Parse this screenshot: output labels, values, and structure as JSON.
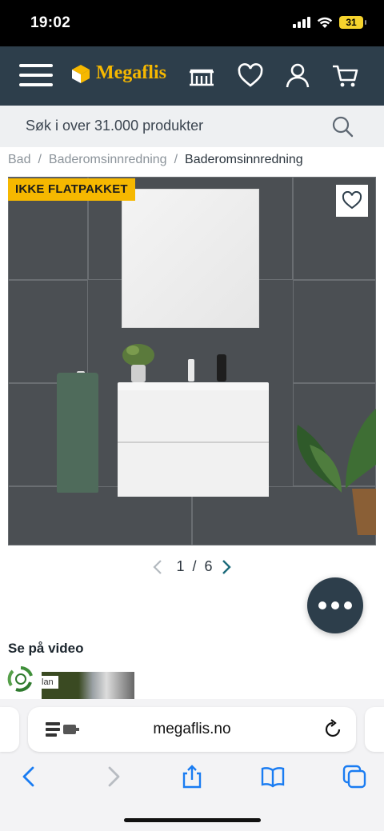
{
  "status": {
    "time": "19:02",
    "battery": "31"
  },
  "header": {
    "logo": "Megaflis"
  },
  "search": {
    "placeholder": "Søk i over 31.000 produkter"
  },
  "breadcrumb": {
    "items": [
      "Bad",
      "Baderomsinnredning"
    ],
    "current": "Baderomsinnredning",
    "separator": "/"
  },
  "product": {
    "badge": "IKKE FLATPAKKET"
  },
  "pager": {
    "current": "1",
    "separator": "/",
    "total": "6"
  },
  "video": {
    "title": "Se på video",
    "thumb_label": "lan"
  },
  "browser": {
    "url": "megaflis.no"
  },
  "colors": {
    "header_bg": "#2d3e4b",
    "accent": "#f6b800",
    "safari_blue": "#1a7cf2"
  }
}
